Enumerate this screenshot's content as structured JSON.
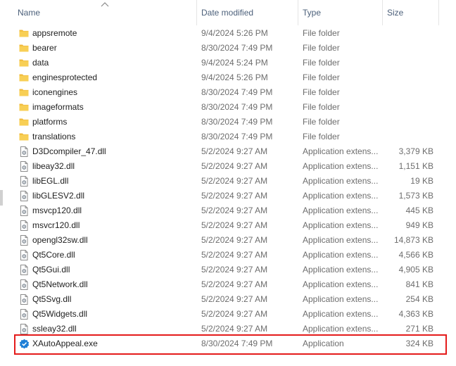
{
  "columns": {
    "name": "Name",
    "date": "Date modified",
    "type": "Type",
    "size": "Size"
  },
  "rows": [
    {
      "name": "appsremote",
      "date": "9/4/2024 5:26 PM",
      "type": "File folder",
      "size": "",
      "icon": "folder-icon"
    },
    {
      "name": "bearer",
      "date": "8/30/2024 7:49 PM",
      "type": "File folder",
      "size": "",
      "icon": "folder-icon"
    },
    {
      "name": "data",
      "date": "9/4/2024 5:24 PM",
      "type": "File folder",
      "size": "",
      "icon": "folder-icon"
    },
    {
      "name": "enginesprotected",
      "date": "9/4/2024 5:26 PM",
      "type": "File folder",
      "size": "",
      "icon": "folder-icon"
    },
    {
      "name": "iconengines",
      "date": "8/30/2024 7:49 PM",
      "type": "File folder",
      "size": "",
      "icon": "folder-icon"
    },
    {
      "name": "imageformats",
      "date": "8/30/2024 7:49 PM",
      "type": "File folder",
      "size": "",
      "icon": "folder-icon"
    },
    {
      "name": "platforms",
      "date": "8/30/2024 7:49 PM",
      "type": "File folder",
      "size": "",
      "icon": "folder-icon"
    },
    {
      "name": "translations",
      "date": "8/30/2024 7:49 PM",
      "type": "File folder",
      "size": "",
      "icon": "folder-icon"
    },
    {
      "name": "D3Dcompiler_47.dll",
      "date": "5/2/2024 9:27 AM",
      "type": "Application extens...",
      "size": "3,379 KB",
      "icon": "dll-file-icon"
    },
    {
      "name": "libeay32.dll",
      "date": "5/2/2024 9:27 AM",
      "type": "Application extens...",
      "size": "1,151 KB",
      "icon": "dll-file-icon"
    },
    {
      "name": "libEGL.dll",
      "date": "5/2/2024 9:27 AM",
      "type": "Application extens...",
      "size": "19 KB",
      "icon": "dll-file-icon"
    },
    {
      "name": "libGLESV2.dll",
      "date": "5/2/2024 9:27 AM",
      "type": "Application extens...",
      "size": "1,573 KB",
      "icon": "dll-file-icon"
    },
    {
      "name": "msvcp120.dll",
      "date": "5/2/2024 9:27 AM",
      "type": "Application extens...",
      "size": "445 KB",
      "icon": "dll-file-icon"
    },
    {
      "name": "msvcr120.dll",
      "date": "5/2/2024 9:27 AM",
      "type": "Application extens...",
      "size": "949 KB",
      "icon": "dll-file-icon"
    },
    {
      "name": "opengl32sw.dll",
      "date": "5/2/2024 9:27 AM",
      "type": "Application extens...",
      "size": "14,873 KB",
      "icon": "dll-file-icon"
    },
    {
      "name": "Qt5Core.dll",
      "date": "5/2/2024 9:27 AM",
      "type": "Application extens...",
      "size": "4,566 KB",
      "icon": "dll-file-icon"
    },
    {
      "name": "Qt5Gui.dll",
      "date": "5/2/2024 9:27 AM",
      "type": "Application extens...",
      "size": "4,905 KB",
      "icon": "dll-file-icon"
    },
    {
      "name": "Qt5Network.dll",
      "date": "5/2/2024 9:27 AM",
      "type": "Application extens...",
      "size": "841 KB",
      "icon": "dll-file-icon"
    },
    {
      "name": "Qt5Svg.dll",
      "date": "5/2/2024 9:27 AM",
      "type": "Application extens...",
      "size": "254 KB",
      "icon": "dll-file-icon"
    },
    {
      "name": "Qt5Widgets.dll",
      "date": "5/2/2024 9:27 AM",
      "type": "Application extens...",
      "size": "4,363 KB",
      "icon": "dll-file-icon"
    },
    {
      "name": "ssleay32.dll",
      "date": "5/2/2024 9:27 AM",
      "type": "Application extens...",
      "size": "271 KB",
      "icon": "dll-file-icon"
    },
    {
      "name": "XAutoAppeal.exe",
      "date": "8/30/2024 7:49 PM",
      "type": "Application",
      "size": "324 KB",
      "icon": "app-exe-icon"
    }
  ],
  "colors": {
    "highlight_border": "#e41b1b",
    "folder": "#f8cf55",
    "header_text": "#4c607a"
  }
}
